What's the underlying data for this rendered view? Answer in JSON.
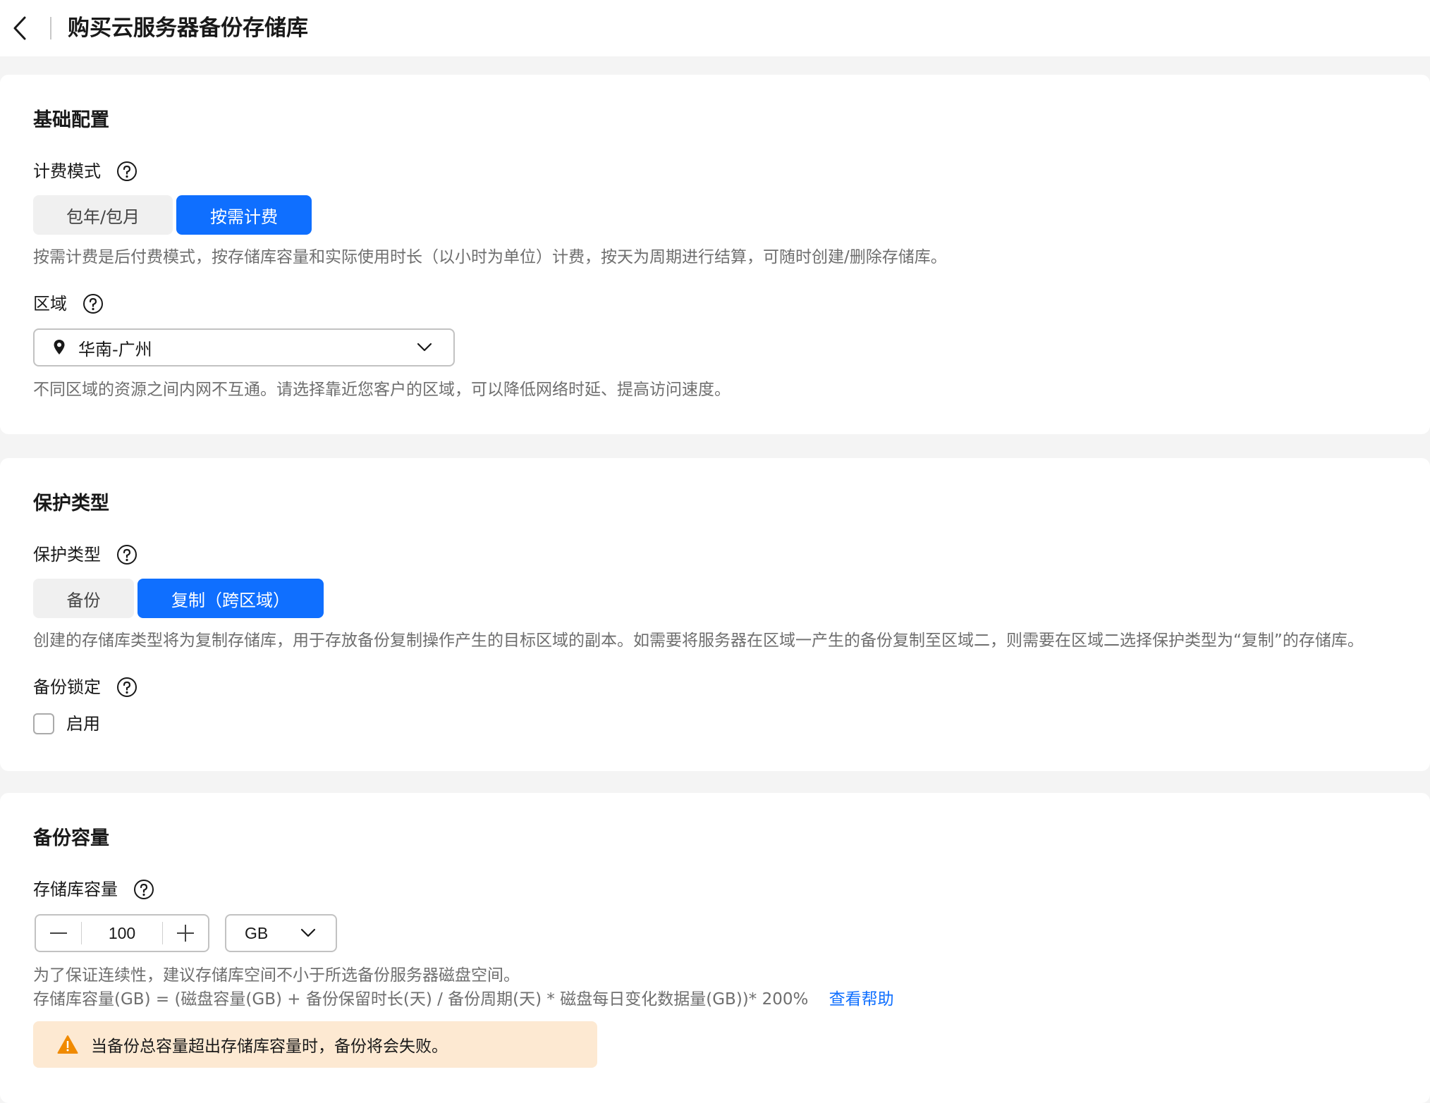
{
  "header": {
    "title": "购买云服务器备份存储库"
  },
  "basic": {
    "section_title": "基础配置",
    "billing": {
      "label": "计费模式",
      "options": [
        "包年/包月",
        "按需计费"
      ],
      "selected": "按需计费",
      "hint": "按需计费是后付费模式，按存储库容量和实际使用时长（以小时为单位）计费，按天为周期进行结算，可随时创建/删除存储库。"
    },
    "region": {
      "label": "区域",
      "value": "华南-广州",
      "hint": "不同区域的资源之间内网不互通。请选择靠近您客户的区域，可以降低网络时延、提高访问速度。"
    }
  },
  "protection": {
    "section_title": "保护类型",
    "type": {
      "label": "保护类型",
      "options": [
        "备份",
        "复制（跨区域）"
      ],
      "selected": "复制（跨区域）",
      "hint": "创建的存储库类型将为复制存储库，用于存放备份复制操作产生的目标区域的副本。如需要将服务器在区域一产生的备份复制至区域二，则需要在区域二选择保护类型为“复制”的存储库。"
    },
    "lock": {
      "label": "备份锁定",
      "checkbox_label": "启用",
      "checked": false
    }
  },
  "capacity": {
    "section_title": "备份容量",
    "label": "存储库容量",
    "value": "100",
    "unit": "GB",
    "hint1": "为了保证连续性，建议存储库空间不小于所选备份服务器磁盘空间。",
    "hint2": "存储库容量(GB) = (磁盘容量(GB) + 备份保留时长(天) / 备份周期(天) * 磁盘每日变化数据量(GB))* 200%",
    "help_link": "查看帮助",
    "warning": "当备份总容量超出存储库容量时，备份将会失败。"
  },
  "colors": {
    "primary": "#0f6fff",
    "warning_bg": "#fde9d2",
    "warning_icon": "#f08a00"
  }
}
